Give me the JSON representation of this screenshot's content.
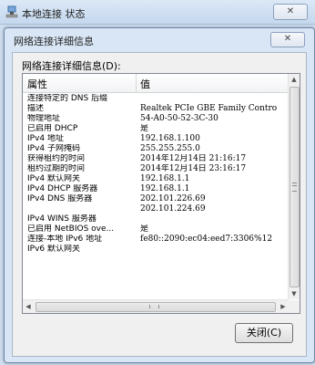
{
  "background_window": {
    "title": "本地连接 状态",
    "close_glyph": "✕"
  },
  "dialog": {
    "title": "网络连接详细信息",
    "close_glyph": "✕",
    "details_label": "网络连接详细信息(D):",
    "columns": [
      "属性",
      "值"
    ],
    "rows": [
      {
        "property": "连接特定的 DNS 后缀",
        "value": ""
      },
      {
        "property": "描述",
        "value": "Realtek PCIe GBE Family Contro"
      },
      {
        "property": "物理地址",
        "value": "54-A0-50-52-3C-30"
      },
      {
        "property": "已启用 DHCP",
        "value": "是"
      },
      {
        "property": "IPv4 地址",
        "value": "192.168.1.100"
      },
      {
        "property": "IPv4 子网掩码",
        "value": "255.255.255.0"
      },
      {
        "property": "获得租约的时间",
        "value": "2014年12月14日 21:16:17"
      },
      {
        "property": "租约过期的时间",
        "value": "2014年12月14日 23:16:17"
      },
      {
        "property": "IPv4 默认网关",
        "value": "192.168.1.1"
      },
      {
        "property": "IPv4 DHCP 服务器",
        "value": "192.168.1.1"
      },
      {
        "property": "IPv4 DNS 服务器",
        "value": "202.101.226.69"
      },
      {
        "property": "",
        "value": "202.101.224.69"
      },
      {
        "property": "IPv4 WINS 服务器",
        "value": ""
      },
      {
        "property": "已启用 NetBIOS ove...",
        "value": "是"
      },
      {
        "property": "连接-本地 IPv6 地址",
        "value": "fe80::2090:ec04:eed7:3306%12"
      },
      {
        "property": "IPv6 默认网关",
        "value": ""
      }
    ],
    "scroll_up": "▲",
    "scroll_down": "▼",
    "scroll_left": "◀",
    "scroll_right": "▶",
    "close_button_label": "关闭(C)"
  },
  "colors": {
    "titlebar": "#c5d8ee",
    "dialog_frame": "#d9e6f5",
    "body_bg": "#f0f0f0"
  },
  "icons": {
    "window_icon": "network-adapter-icon"
  }
}
